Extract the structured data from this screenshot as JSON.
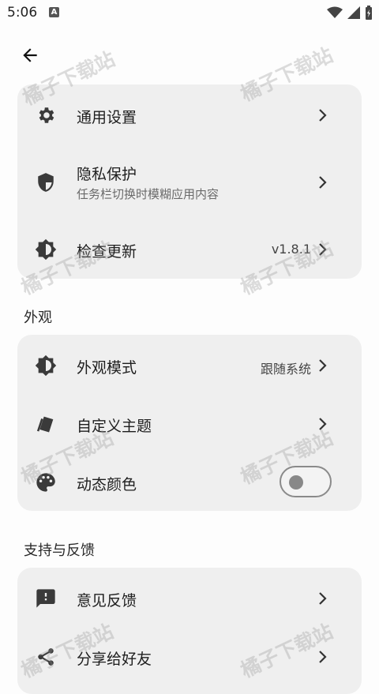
{
  "status_bar": {
    "time": "5:06",
    "notification_letter": "A"
  },
  "watermark_text": "橘子下载站",
  "general_card": {
    "items": [
      {
        "title": "通用设置",
        "icon": "gear-icon"
      },
      {
        "title": "隐私保护",
        "subtitle": "任务栏切换时模糊应用内容",
        "icon": "shield-icon"
      },
      {
        "title": "检查更新",
        "value": "v1.8.1",
        "icon": "brightness-icon"
      }
    ]
  },
  "appearance_section": {
    "label": "外观",
    "items": [
      {
        "title": "外观模式",
        "value": "跟随系统",
        "icon": "brightness-icon"
      },
      {
        "title": "自定义主题",
        "icon": "cards-icon"
      },
      {
        "title": "动态颜色",
        "icon": "palette-icon",
        "toggle_on": false
      }
    ]
  },
  "support_section": {
    "label": "支持与反馈",
    "items": [
      {
        "title": "意见反馈",
        "icon": "feedback-icon"
      },
      {
        "title": "分享给好友",
        "icon": "share-icon"
      }
    ]
  },
  "colors": {
    "card_bg": "#efefef",
    "page_bg": "#fdfdfd"
  }
}
